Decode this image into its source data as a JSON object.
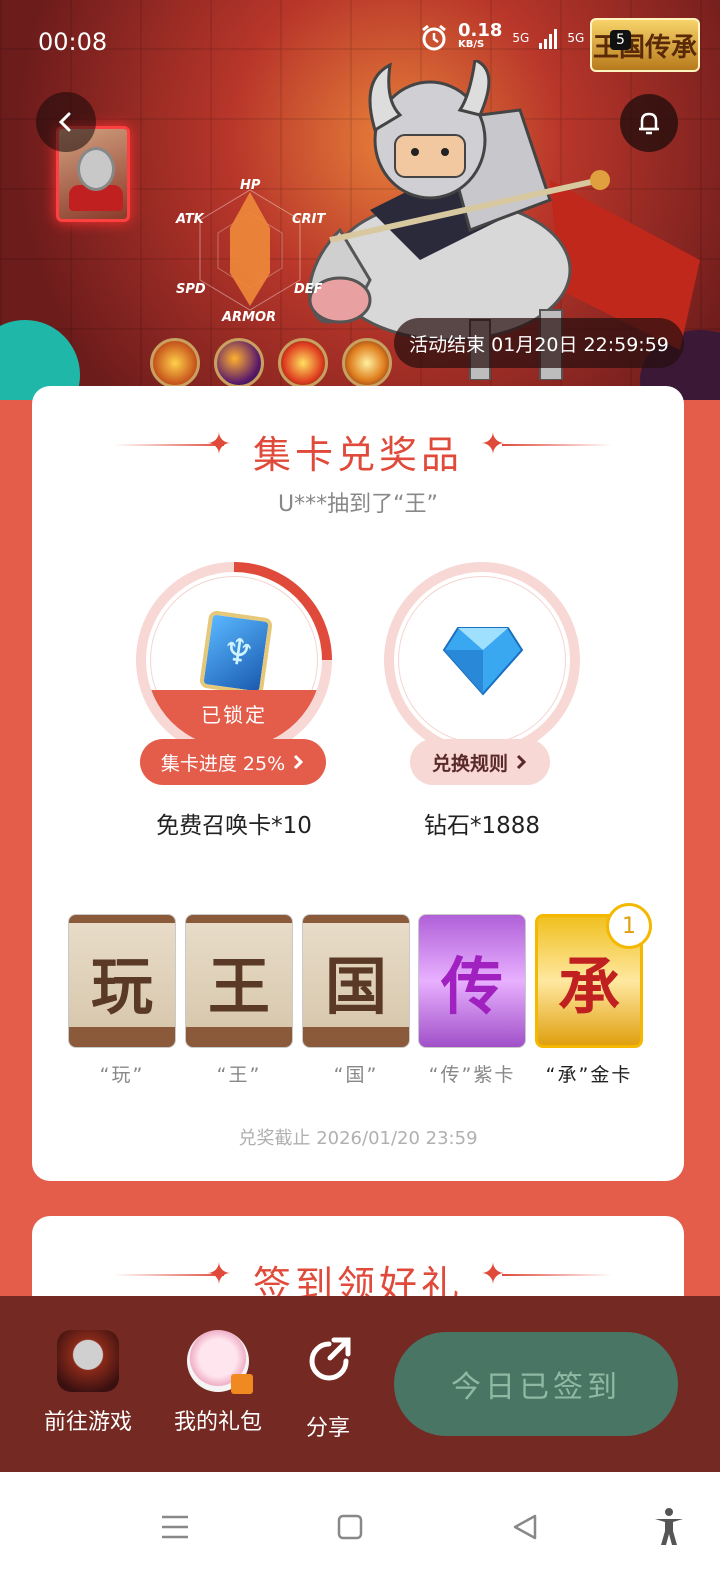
{
  "status_bar": {
    "time": "00:08",
    "net_speed": "0.18",
    "net_unit": "KB/S",
    "signal_1": "5G",
    "signal_2": "5G",
    "battery": "5"
  },
  "logo": {
    "text": "王国传承"
  },
  "hero": {
    "stats": [
      "HP",
      "CRIT",
      "DEF",
      "ARMOR",
      "SPD",
      "ATK"
    ],
    "event_end": "活动结束 01月20日 22:59:59",
    "skills": [
      "skill-fire-icon",
      "skill-moon-icon",
      "skill-burst-icon",
      "skill-flame-icon"
    ]
  },
  "card_collect": {
    "title": "集卡兑奖品",
    "ticker": "U***抽到了“王”",
    "prizes": [
      {
        "status": "已锁定",
        "progress_label": "集卡进度 25%",
        "progress": 0.25,
        "name": "免费召唤卡*10"
      },
      {
        "action_label": "兑换规则",
        "name": "钻石*1888"
      }
    ],
    "letters": [
      {
        "char": "玩",
        "label": "“玩”"
      },
      {
        "char": "王",
        "label": "“王”"
      },
      {
        "char": "国",
        "label": "“国”"
      },
      {
        "char": "传",
        "label": "“传”紫卡"
      },
      {
        "char": "承",
        "label": "“承”金卡",
        "count": "1"
      }
    ],
    "deadline": "兑奖截止 2026/01/20 23:59"
  },
  "signin": {
    "title": "签到领好礼"
  },
  "bottom_bar": {
    "game_label": "前往游戏",
    "gift_label": "我的礼包",
    "share_label": "分享",
    "signed_label": "今日已签到"
  },
  "colors": {
    "background": "#e45c4a",
    "accent": "#e04a3a",
    "bottom_bar": "#742a22",
    "signed_button": "#497565"
  }
}
